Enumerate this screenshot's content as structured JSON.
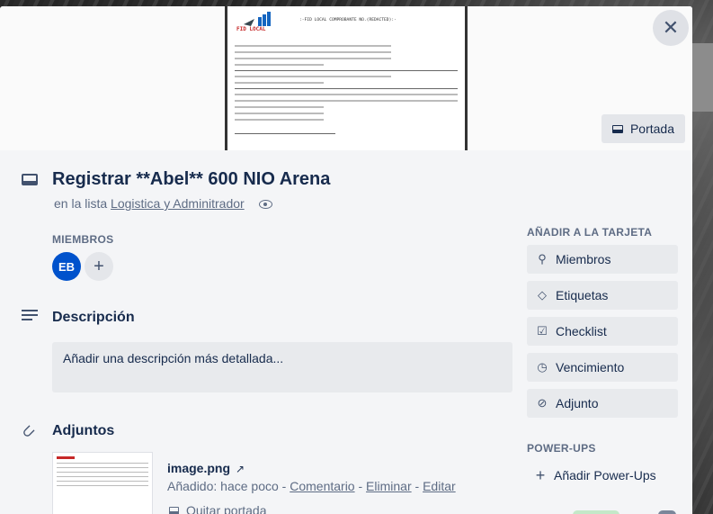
{
  "cover": {
    "doc_logo_text": "FID LOCAL",
    "doc_title": ":-FID LOCAL COMPROBANTE NO.(REDACTED):-",
    "button_label": "Portada"
  },
  "card": {
    "title": "Registrar **Abel** 600 NIO Arena",
    "list_prefix": "en la lista",
    "list_name": "Logistica y Adminitrador"
  },
  "members": {
    "heading": "MIEMBROS",
    "avatar_initials": "EB"
  },
  "description": {
    "heading": "Descripción",
    "placeholder": "Añadir una descripción más detallada..."
  },
  "attachments": {
    "heading": "Adjuntos",
    "file_name": "image.png",
    "added_text": "Añadido: hace poco",
    "comment_link": "Comentario",
    "delete_link": "Eliminar",
    "edit_link": "Editar",
    "remove_cover": "Quitar portada"
  },
  "sidebar": {
    "add_heading": "AÑADIR A LA TARJETA",
    "buttons": [
      {
        "label": "Miembros",
        "icon": "person-icon"
      },
      {
        "label": "Etiquetas",
        "icon": "tag-icon"
      },
      {
        "label": "Checklist",
        "icon": "checkbox-icon"
      },
      {
        "label": "Vencimiento",
        "icon": "clock-icon"
      },
      {
        "label": "Adjunto",
        "icon": "paperclip-icon"
      }
    ],
    "powerups_heading": "POWER-UPS",
    "add_powerups": "Añadir Power-Ups"
  }
}
